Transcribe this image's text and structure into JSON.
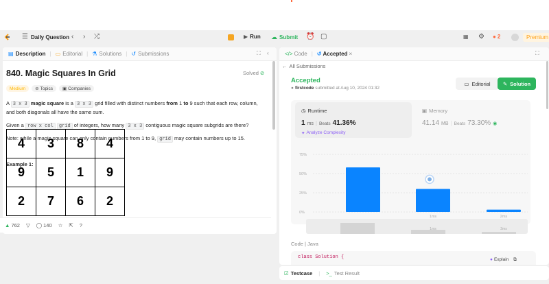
{
  "nav": {
    "daily_question": "Daily Question",
    "run": "Run",
    "submit": "Submit",
    "streak_count": "2",
    "premium": "Premium"
  },
  "left": {
    "tabs": [
      "Description",
      "Editorial",
      "Solutions",
      "Submissions"
    ],
    "title": "840. Magic Squares In Grid",
    "solved": "Solved",
    "difficulty": "Medium",
    "topics": "Topics",
    "companies": "Companies",
    "p1": {
      "a": "A ",
      "code1": "3 x 3",
      "b": " magic square",
      "c": " is a ",
      "code2": "3 x 3",
      "d": " grid filled with distinct numbers ",
      "e": "from",
      "f": " 1 ",
      "g": "to",
      "h": " 9 such that each row, column, and both diagonals all have the same sum."
    },
    "p2": {
      "a": "Given a ",
      "code1": "row x col",
      "code2": "grid",
      "b": " of integers, how many ",
      "code3": "3 x 3",
      "c": " contiguous magic square subgrids are there?"
    },
    "p3": {
      "a": "Note: while a magic square can only contain numbers from 1 to 9, ",
      "code1": "grid",
      "b": " may contain numbers up to 15."
    },
    "example_title": "Example 1:",
    "grid": [
      [
        "4",
        "3",
        "8",
        "4"
      ],
      [
        "9",
        "5",
        "1",
        "9"
      ],
      [
        "2",
        "7",
        "6",
        "2"
      ]
    ],
    "likes": "762",
    "comments": "140"
  },
  "right": {
    "tabs": {
      "code": "Code",
      "accepted": "Accepted"
    },
    "all_submissions": "All Submissions",
    "status": "Accepted",
    "submitted_by": "firstcode",
    "submitted_at": "submitted at Aug 10, 2024 01:32",
    "editorial_btn": "Editorial",
    "solution_btn": "Solution",
    "runtime_label": "Runtime",
    "runtime_value": "1",
    "runtime_unit": "ms",
    "beats_label": "Beats",
    "runtime_beats": "41.36%",
    "analyze": "Analyze Complexity",
    "memory_label": "Memory",
    "memory_value": "41.14",
    "memory_unit": "MB",
    "memory_beats": "73.30%",
    "code_lang": "Code | Java",
    "code_line": "class Solution {",
    "explain": "Explain",
    "testcase": "Testcase",
    "test_result": "Test Result"
  },
  "chart_data": {
    "type": "bar",
    "yticks": [
      "75%",
      "50%",
      "25%",
      "0%"
    ],
    "ylim": [
      0,
      75
    ],
    "categories": [
      "",
      "1ms",
      "2ms"
    ],
    "values": [
      58,
      30,
      3
    ],
    "highlight_index": 1,
    "colors": {
      "bar": "#0a84ff",
      "accent": "#2db55d"
    }
  }
}
